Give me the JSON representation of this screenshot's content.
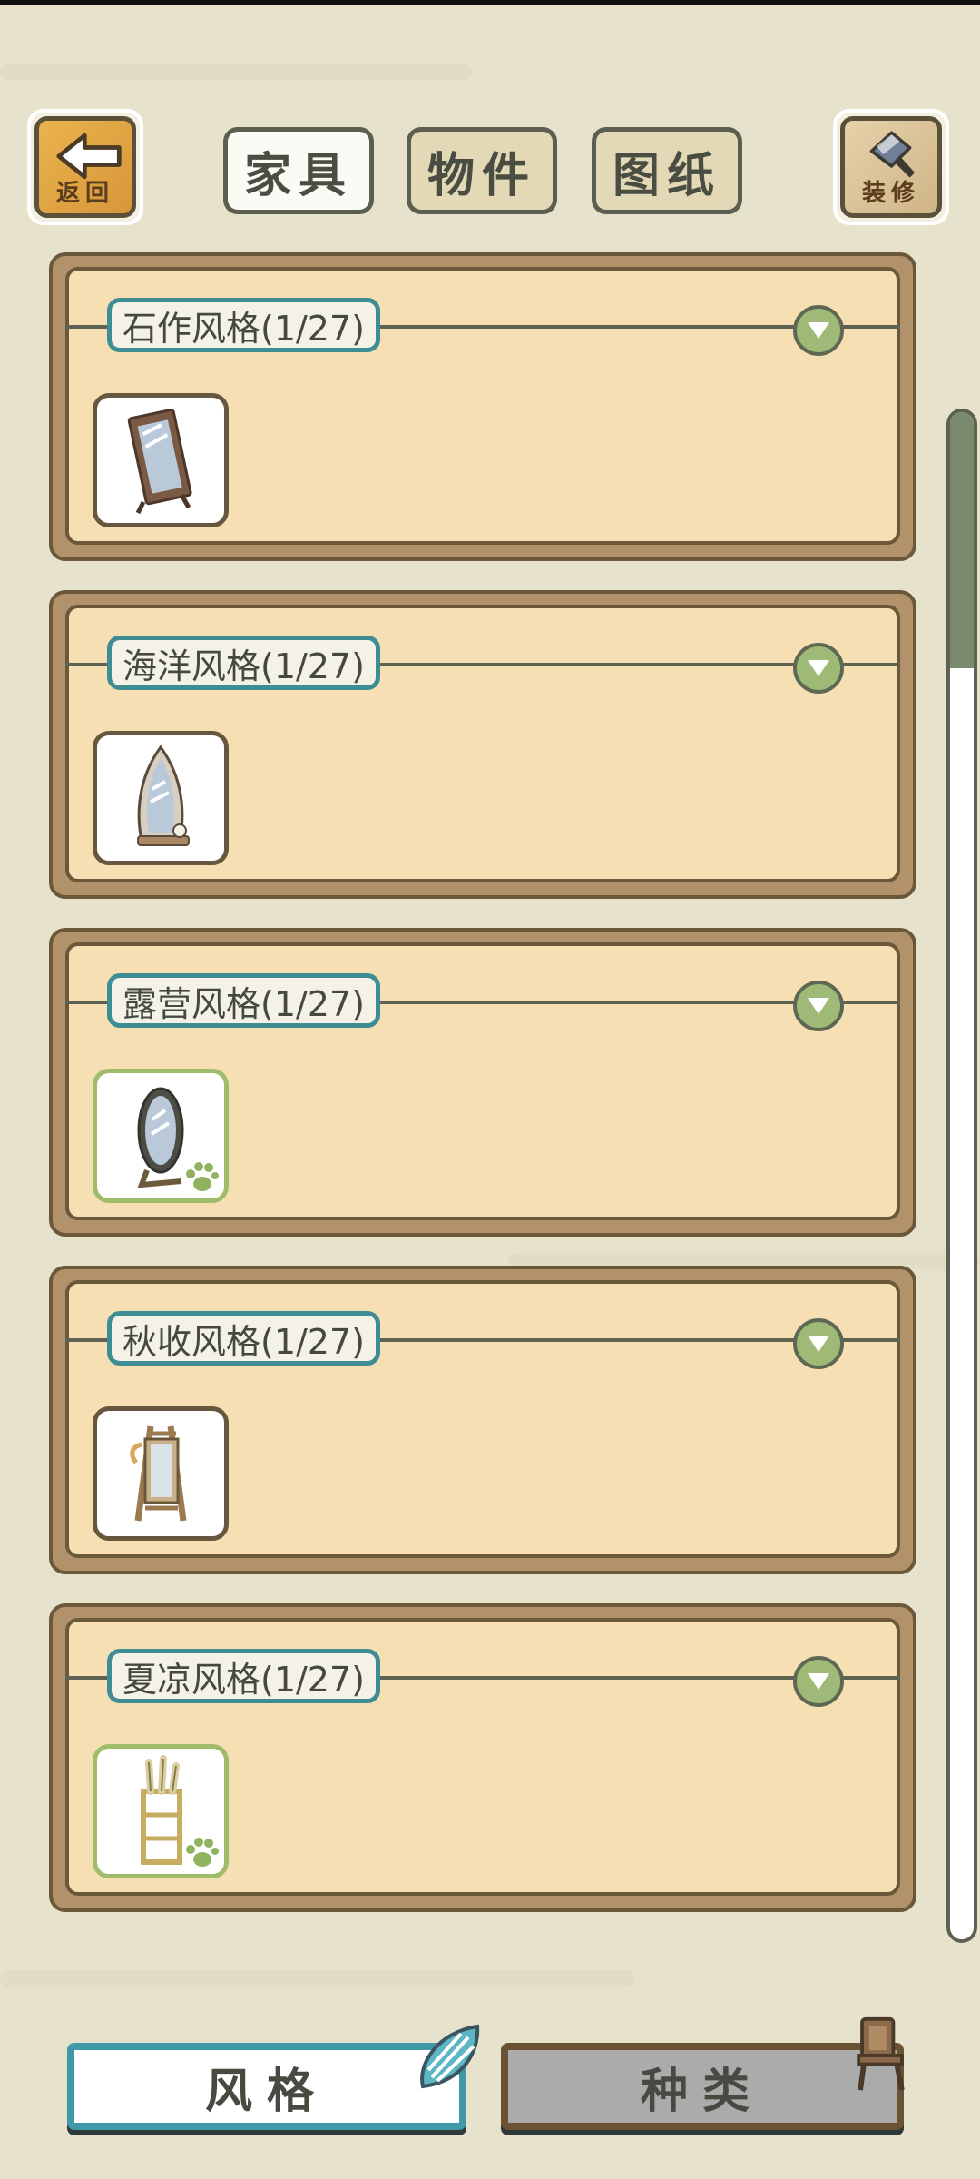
{
  "header": {
    "back_label": "返回",
    "decorate_label": "装修",
    "tabs": [
      {
        "label": "家具",
        "active": true
      },
      {
        "label": "物件",
        "active": false
      },
      {
        "label": "图纸",
        "active": false
      }
    ]
  },
  "sections": [
    {
      "title": "石作风格(1/27)",
      "item_icon": "stone-mirror-icon",
      "owned": false
    },
    {
      "title": "海洋风格(1/27)",
      "item_icon": "ocean-mirror-icon",
      "owned": false
    },
    {
      "title": "露营风格(1/27)",
      "item_icon": "camping-mirror-icon",
      "owned": true
    },
    {
      "title": "秋收风格(1/27)",
      "item_icon": "harvest-mirror-icon",
      "owned": false
    },
    {
      "title": "夏凉风格(1/27)",
      "item_icon": "summer-shelf-icon",
      "owned": true
    }
  ],
  "bottom_tabs": [
    {
      "label": "风格",
      "active": true,
      "icon": "shell-icon"
    },
    {
      "label": "种类",
      "active": false,
      "icon": "chair-icon"
    }
  ],
  "colors": {
    "background": "#e6e2cb",
    "panel": "#f5dfb3",
    "panel_border": "#b1926a",
    "title_border": "#3f8d94",
    "expand_button": "#9eba76",
    "owned_border": "#9ebc6a",
    "active_tab_border": "#3f99a7"
  }
}
